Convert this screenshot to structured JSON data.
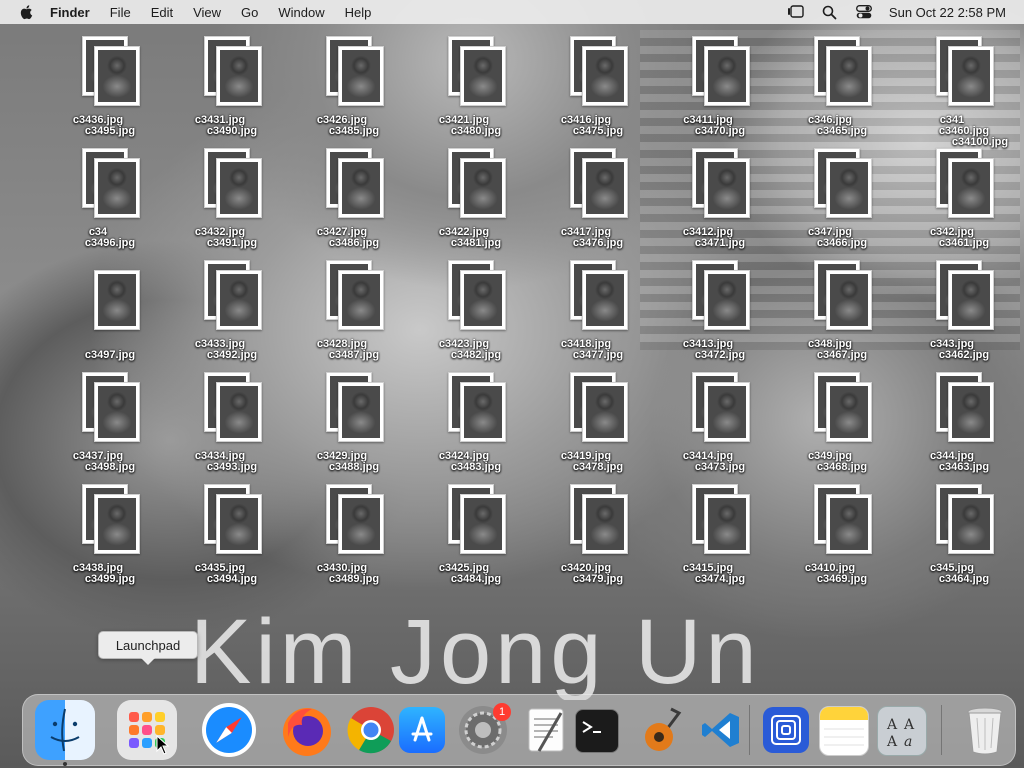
{
  "menubar": {
    "app_name": "Finder",
    "items": [
      "File",
      "Edit",
      "View",
      "Go",
      "Window",
      "Help"
    ],
    "clock": "Sun Oct 22  2:58 PM"
  },
  "wallpaper_text": "Kim Jong Un",
  "desktop": {
    "back_row_labels": [
      [
        "c3436.jpg",
        "c3431.jpg",
        "c3426.jpg",
        "c3421.jpg",
        "c3416.jpg",
        "c3411.jpg",
        "c346.jpg",
        "c341"
      ],
      [
        "c34",
        "c3432.jpg",
        "c3427.jpg",
        "c3422.jpg",
        "c3417.jpg",
        "c3412.jpg",
        "c347.jpg",
        "c342.jpg"
      ],
      [
        "",
        "c3433.jpg",
        "c3428.jpg",
        "c3423.jpg",
        "c3418.jpg",
        "c3413.jpg",
        "c348.jpg",
        "c343.jpg"
      ],
      [
        "c3437.jpg",
        "c3434.jpg",
        "c3429.jpg",
        "c3424.jpg",
        "c3419.jpg",
        "c3414.jpg",
        "c349.jpg",
        "c344.jpg"
      ],
      [
        "c3438.jpg",
        "c3435.jpg",
        "c3430.jpg",
        "c3425.jpg",
        "c3420.jpg",
        "c3415.jpg",
        "c3410.jpg",
        "c345.jpg"
      ]
    ],
    "front_row_labels": [
      [
        "c3495.jpg",
        "c3490.jpg",
        "c3485.jpg",
        "c3480.jpg",
        "c3475.jpg",
        "c3470.jpg",
        "c3465.jpg",
        "c3460.jpg"
      ],
      [
        "c3496.jpg",
        "c3491.jpg",
        "c3486.jpg",
        "c3481.jpg",
        "c3476.jpg",
        "c3471.jpg",
        "c3466.jpg",
        "c3461.jpg"
      ],
      [
        "c3497.jpg",
        "c3492.jpg",
        "c3487.jpg",
        "c3482.jpg",
        "c3477.jpg",
        "c3472.jpg",
        "c3467.jpg",
        "c3462.jpg"
      ],
      [
        "c3498.jpg",
        "c3493.jpg",
        "c3488.jpg",
        "c3483.jpg",
        "c3478.jpg",
        "c3473.jpg",
        "c3468.jpg",
        "c3463.jpg"
      ],
      [
        "c3499.jpg",
        "c3494.jpg",
        "c3489.jpg",
        "c3484.jpg",
        "c3479.jpg",
        "c3474.jpg",
        "c3469.jpg",
        "c3464.jpg"
      ]
    ],
    "extra_label": "c34100.jpg"
  },
  "tooltip": "Launchpad",
  "dock": {
    "apps": [
      {
        "name": "Finder",
        "icon": "finder-icon",
        "running": true
      },
      {
        "name": "Launchpad",
        "icon": "launchpad-icon"
      },
      {
        "name": "Safari",
        "icon": "safari-icon"
      },
      {
        "name": "Firefox",
        "icon": "firefox-icon"
      },
      {
        "name": "Chrome",
        "icon": "chrome-icon"
      },
      {
        "name": "App Store",
        "icon": "app-store-icon"
      },
      {
        "name": "System Preferences",
        "icon": "system-preferences-icon",
        "badge": "1"
      },
      {
        "name": "TextEdit",
        "icon": "textedit-icon"
      },
      {
        "name": "Terminal",
        "icon": "terminal-icon"
      },
      {
        "name": "GarageBand",
        "icon": "garageband-icon"
      },
      {
        "name": "Visual Studio Code",
        "icon": "vscode-icon"
      },
      {
        "name": "Screen Sharing",
        "icon": "screen-sharing-icon"
      },
      {
        "name": "Notes",
        "icon": "notes-icon"
      },
      {
        "name": "Font Book",
        "icon": "font-book-icon"
      },
      {
        "name": "Trash",
        "icon": "trash-icon"
      }
    ]
  },
  "colors": {
    "menubar_bg": "#ebebeb",
    "badge": "#ff3b30",
    "vscode": "#1f7fd1"
  }
}
